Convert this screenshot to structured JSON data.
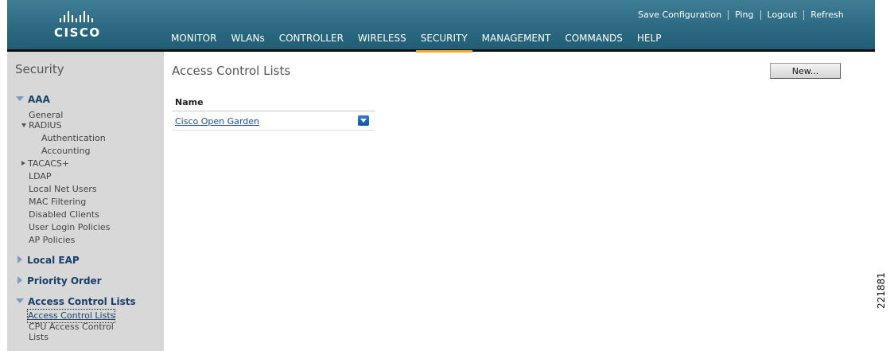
{
  "brand": {
    "logo_text": "CISCO"
  },
  "utility_links": [
    {
      "label": "Save Configuration"
    },
    {
      "label": "Ping"
    },
    {
      "label": "Logout"
    },
    {
      "label": "Refresh"
    }
  ],
  "nav": {
    "tabs": [
      {
        "label": "MONITOR"
      },
      {
        "label": "WLANs"
      },
      {
        "label": "CONTROLLER"
      },
      {
        "label": "WIRELESS"
      },
      {
        "label": "SECURITY"
      },
      {
        "label": "MANAGEMENT"
      },
      {
        "label": "COMMANDS"
      },
      {
        "label": "HELP"
      }
    ],
    "active": "SECURITY"
  },
  "sidebar": {
    "title": "Security",
    "aaa": {
      "label": "AAA",
      "items": {
        "general": "General",
        "radius": "RADIUS",
        "authentication": "Authentication",
        "accounting": "Accounting",
        "tacacs": "TACACS+",
        "ldap": "LDAP",
        "local_net_users": "Local Net Users",
        "mac_filtering": "MAC Filtering",
        "disabled_clients": "Disabled Clients",
        "user_login_policies": "User Login Policies",
        "ap_policies": "AP Policies"
      }
    },
    "local_eap": "Local EAP",
    "priority_order": "Priority Order",
    "acl": {
      "label": "Access Control Lists",
      "items": {
        "acl": "Access Control Lists",
        "cpu_acl_line1": "CPU Access Control",
        "cpu_acl_line2": "Lists"
      }
    }
  },
  "main": {
    "title": "Access Control Lists",
    "new_button": "New...",
    "table": {
      "header": "Name",
      "rows": [
        {
          "name": "Cisco Open Garden"
        }
      ]
    }
  },
  "figure_id": "221881",
  "colors": {
    "header": "#2b6a82",
    "active_tab_underline": "#f5a623",
    "sidebar_bg": "#d8d8d8",
    "link": "#1a4fa0",
    "dropdown": "#1565c0"
  }
}
